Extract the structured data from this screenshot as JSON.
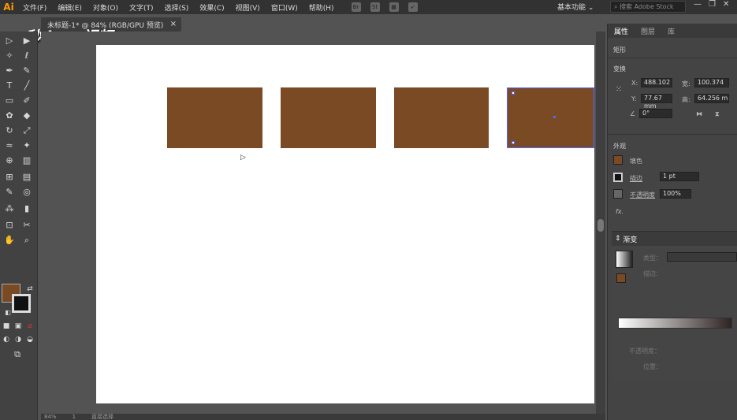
{
  "app": {
    "logo": "Ai",
    "menus": [
      "文件(F)",
      "编辑(E)",
      "对象(O)",
      "文字(T)",
      "选择(S)",
      "效果(C)",
      "视图(V)",
      "窗口(W)",
      "帮助(H)"
    ],
    "workspace": "基本功能",
    "stock_search_placeholder": "搜索 Adobe Stock"
  },
  "document": {
    "tab_title": "未标题-1* @ 84% (RGB/GPU 预览)",
    "close": "×"
  },
  "watermark": "秒dong视频",
  "canvas": {
    "fill_color": "#7a4a25",
    "rect_count": 4
  },
  "status": {
    "zoom": "84%",
    "page": "1",
    "tool": "直接选择"
  },
  "properties_panel": {
    "tabs": [
      "属性",
      "图层",
      "库"
    ],
    "object_type": "矩形",
    "transform_label": "变换",
    "x_label": "X:",
    "x_value": "488.102",
    "y_label": "Y:",
    "y_value": "77.67 mm",
    "w_label": "宽:",
    "w_value": "100.374",
    "h_label": "高:",
    "h_value": "64.256 m",
    "angle_value": "0°",
    "appearance_label": "外观",
    "fill_label": "填色",
    "stroke_label": "描边",
    "stroke_value": "1 pt",
    "opacity_label": "不透明度",
    "opacity_value": "100%",
    "fx_label": "fx."
  },
  "gradient_panel": {
    "title": "渐变",
    "type_label": "类型：",
    "stroke_label": "描边：",
    "opacity_label": "不透明度：",
    "position_label": "位置："
  }
}
